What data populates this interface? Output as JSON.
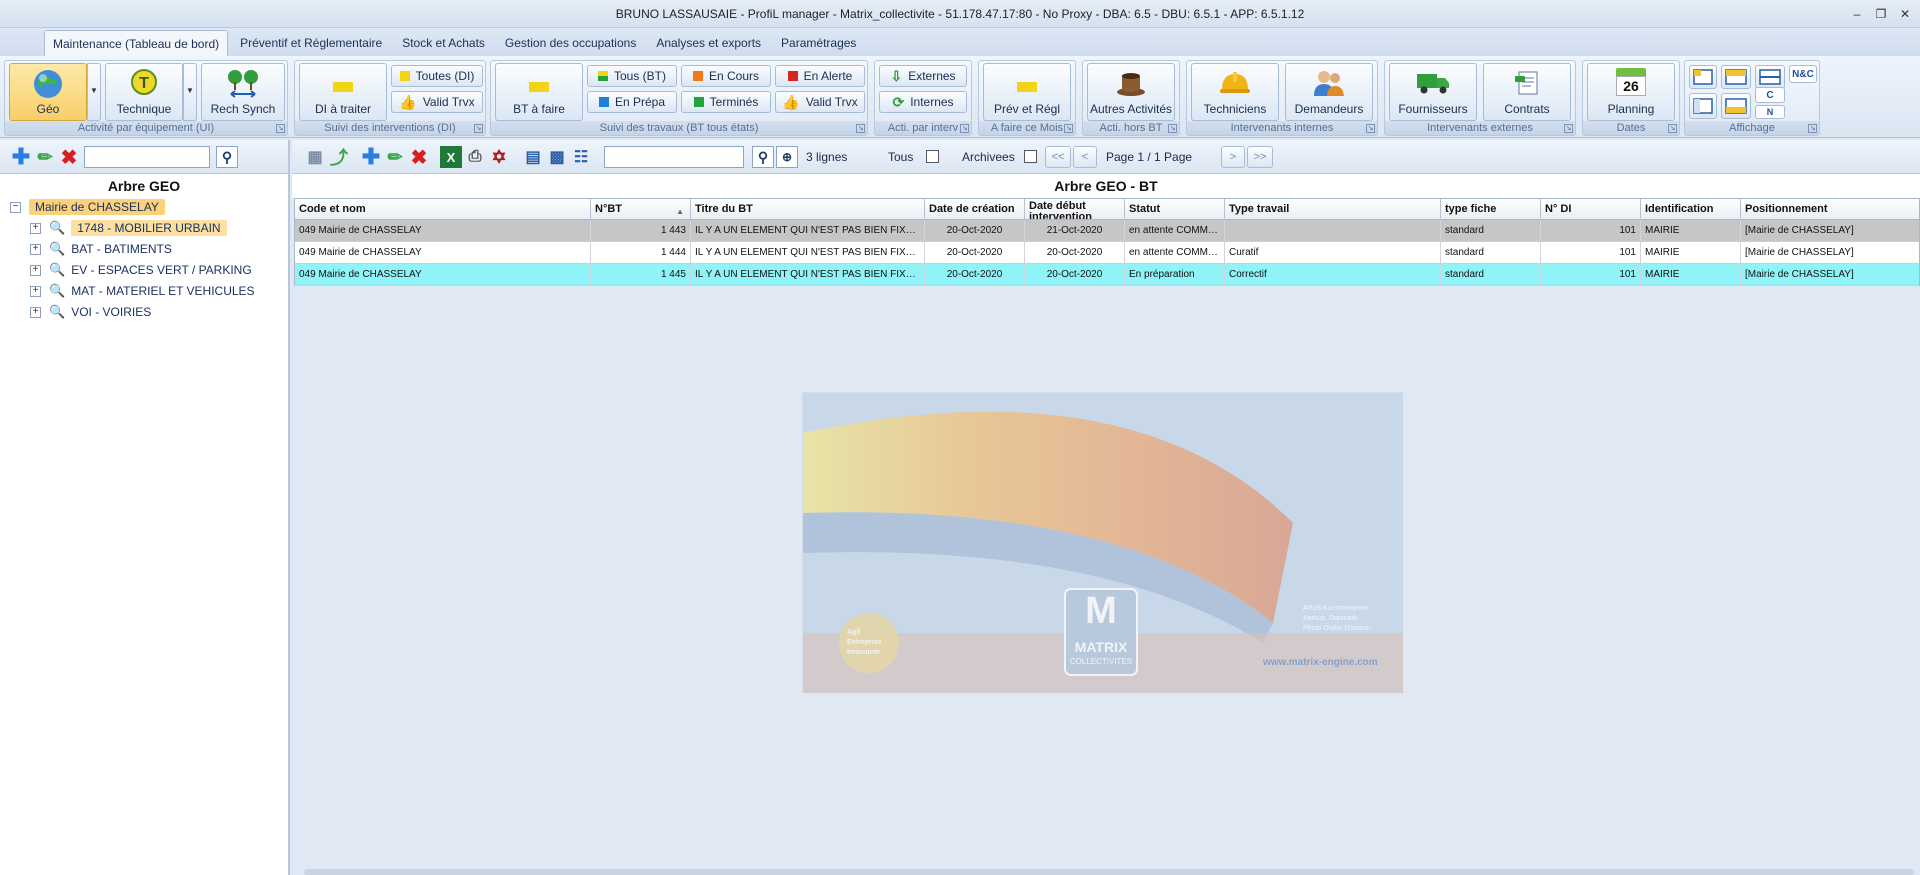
{
  "window": {
    "title": "BRUNO LASSAUSAIE - ProfiL manager - Matrix_collectivite - 51.178.47.17:80 - No Proxy - DBA: 6.5 - DBU: 6.5.1 - APP: 6.5.1.12",
    "controls": [
      "minimize-icon",
      "restore-icon",
      "close-icon"
    ]
  },
  "menu": {
    "tabs": [
      {
        "label": "Maintenance (Tableau de bord)",
        "active": true
      },
      {
        "label": "Préventif et Réglementaire"
      },
      {
        "label": "Stock et Achats"
      },
      {
        "label": "Gestion des occupations"
      },
      {
        "label": "Analyses et exports"
      },
      {
        "label": "Paramétrages"
      }
    ]
  },
  "ribbon": {
    "groups": {
      "activite": "Activité par équipement (UI)",
      "suivi_di": "Suivi des interventions (DI)",
      "suivi_bt": "Suivi des travaux (BT tous états)",
      "acti_interv": "Acti. par interv",
      "a_faire": "A faire ce Mois",
      "acti_hors": "Acti. hors BT",
      "int_internes": "Intervenants internes",
      "int_externes": "Intervenants externes",
      "dates": "Dates",
      "affichage": "Affichage"
    },
    "buttons": {
      "geo": "Géo",
      "technique": "Technique",
      "rech_synch": "Rech Synch",
      "di_a_traiter": "DI à traiter",
      "toutes_di": "Toutes (DI)",
      "valid_trvx_di": "Valid Trvx",
      "bt_a_faire": "BT à faire",
      "tous_bt": "Tous (BT)",
      "en_prepa": "En Prépa",
      "en_cours": "En Cours",
      "termines": "Terminés",
      "en_alerte": "En Alerte",
      "valid_trvx_bt": "Valid Trvx",
      "externes": "Externes",
      "internes": "Internes",
      "prev_regl": "Prév et Régl",
      "autres_activites": "Autres Activités",
      "techniciens": "Techniciens",
      "demandeurs": "Demandeurs",
      "fournisseurs": "Fournisseurs",
      "contrats": "Contrats",
      "planning": "Planning",
      "planning_day": "26",
      "nc": "N&C",
      "c": "C",
      "n": "N"
    },
    "colors": {
      "yellow": "#f2d417",
      "green": "#22a63a",
      "orange": "#f07a1a",
      "red": "#d9261c",
      "blue": "#1e7fd6"
    }
  },
  "left": {
    "search_value": "",
    "title": "Arbre GEO",
    "tree": {
      "root": "Mairie de CHASSELAY",
      "children": [
        "1748 - MOBILIER URBAIN",
        "BAT - BATIMENTS",
        "EV - ESPACES VERT / PARKING",
        "MAT - MATERIEL ET VEHICULES",
        "VOI - VOIRIES"
      ]
    }
  },
  "right": {
    "search_value": "",
    "count": "3 lignes",
    "tous_label": "Tous",
    "archivees_label": "Archivees",
    "page_label": "Page 1 / 1 Page",
    "nav": {
      "first": "<<",
      "prev": "<",
      "next": ">",
      "last": ">>"
    },
    "title": "Arbre GEO - BT",
    "columns": [
      "Code et nom",
      "N°BT",
      "Titre du BT",
      "Date de création",
      "Date début intervention",
      "Statut",
      "Type travail",
      "type fiche",
      "N° DI",
      "Identification",
      "Positionnement"
    ],
    "rows": [
      [
        "049  Mairie de CHASSELAY",
        "1 443",
        "IL Y A UN ELEMENT QUI N'EST PAS BIEN FIXE SUR LE SOL...",
        "20-Oct-2020",
        "21-Oct-2020",
        "en attente COMMANDE",
        "",
        "standard",
        "101",
        "MAIRIE",
        "[Mairie de CHASSELAY]"
      ],
      [
        "049  Mairie de CHASSELAY",
        "1 444",
        "IL Y A UN ELEMENT QUI N'EST PAS BIEN FIXE VERS LE...",
        "20-Oct-2020",
        "20-Oct-2020",
        "en attente COMMANDE",
        "Curatif",
        "standard",
        "101",
        "MAIRIE",
        "[Mairie de CHASSELAY]"
      ],
      [
        "049  Mairie de CHASSELAY",
        "1 445",
        "IL Y A UN ELEMENT QUI N'EST PAS BIEN FIXE SUR LE SOL...",
        "20-Oct-2020",
        "20-Oct-2020",
        "En préparation",
        "Correctif",
        "standard",
        "101",
        "MAIRIE",
        "[Mairie de CHASSELAY]"
      ]
    ]
  },
  "watermark": {
    "logo_letter": "M",
    "logo_text": "MATRIX",
    "logo_sub": "COLLECTIVITES",
    "url": "www.matrix-engine.com",
    "caption_1": "ARoS Kunstmuseum,",
    "caption_2": "Aarhus, Danmark",
    "caption_3": "Photo Olafur Eliasson",
    "badge_1": "Agil",
    "badge_2": "Entreprise",
    "badge_3": "Innovante"
  }
}
